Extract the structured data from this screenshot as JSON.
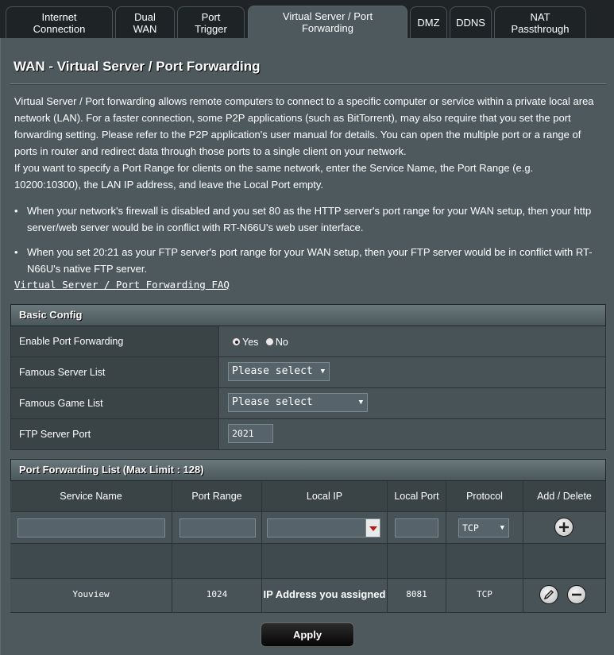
{
  "tabs": [
    {
      "label": "Internet\nConnection"
    },
    {
      "label": "Dual\nWAN"
    },
    {
      "label": "Port\nTrigger"
    },
    {
      "label": "Virtual Server / Port\nForwarding"
    },
    {
      "label": "DMZ"
    },
    {
      "label": "DDNS"
    },
    {
      "label": "NAT\nPassthrough"
    }
  ],
  "page": {
    "title": "WAN - Virtual Server / Port Forwarding",
    "description": "Virtual Server / Port forwarding allows remote computers to connect to a specific computer or service within a private local area network (LAN). For a faster connection, some P2P applications (such as BitTorrent), may also require that you set the port forwarding setting. Please refer to the P2P application's user manual for details. You can open the multiple port or a range of ports in router and redirect data through those ports to a single client on your network.",
    "description2": "If you want to specify a Port Range for clients on the same network, enter the Service Name, the Port Range (e.g. 10200:10300), the LAN IP address, and leave the Local Port empty.",
    "bullet1": "When your network's firewall is disabled and you set 80 as the HTTP server's port range for your WAN setup, then your http server/web server would be in conflict with RT-N66U's web user interface.",
    "bullet2": "When you set 20:21 as your FTP server's port range for your WAN setup, then your FTP server would be in conflict with RT-N66U's native FTP server.",
    "faq_link": "Virtual Server / Port Forwarding FAQ"
  },
  "basic_config": {
    "heading": "Basic Config",
    "enable_label": "Enable Port Forwarding",
    "yes_label": "Yes",
    "no_label": "No",
    "server_list_label": "Famous Server List",
    "server_list_value": "Please select",
    "game_list_label": "Famous Game List",
    "game_list_value": "Please select",
    "ftp_port_label": "FTP Server Port",
    "ftp_port_value": "2021"
  },
  "forward_list": {
    "heading": "Port Forwarding List (Max Limit : 128)",
    "columns": [
      "Service Name",
      "Port Range",
      "Local IP",
      "Local Port",
      "Protocol",
      "Add / Delete"
    ],
    "new_protocol": "TCP",
    "rows": [
      {
        "service": "Youview",
        "port_range": "1024",
        "local_ip": "IP Address you assigned",
        "local_port": "8081",
        "protocol": "TCP"
      }
    ]
  },
  "apply_label": "Apply"
}
